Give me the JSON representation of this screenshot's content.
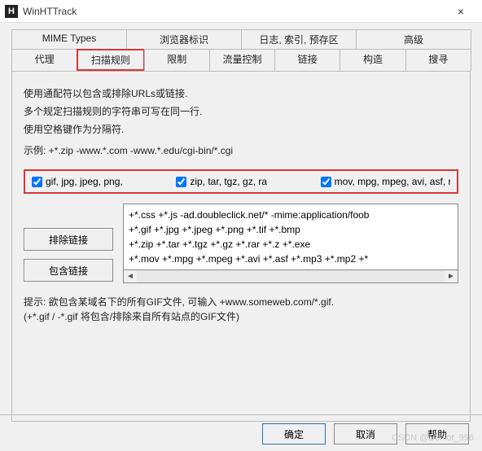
{
  "window": {
    "icon_letter": "H",
    "title": "WinHTTrack",
    "close": "×"
  },
  "tabs_row1": [
    {
      "label": "MIME Types"
    },
    {
      "label": "浏览器标识"
    },
    {
      "label": "日志, 索引, 预存区"
    },
    {
      "label": "高级"
    }
  ],
  "tabs_row2": [
    {
      "label": "代理"
    },
    {
      "label": "扫描规则",
      "active": true
    },
    {
      "label": "限制"
    },
    {
      "label": "流量控制"
    },
    {
      "label": "链接"
    },
    {
      "label": "构造"
    },
    {
      "label": "搜寻"
    }
  ],
  "instructions": {
    "line1": "使用通配符以包含或排除URLs或链接.",
    "line2": "多个规定扫描规则的字符串可写在同一行.",
    "line3": "使用空格键作为分隔符.",
    "example_label": "示例: ",
    "example_text": "+*.zip -www.*.com -www.*.edu/cgi-bin/*.cgi"
  },
  "checkboxes": [
    {
      "label": "gif, jpg, jpeg, png, ",
      "checked": true
    },
    {
      "label": "zip, tar, tgz, gz, ra",
      "checked": true
    },
    {
      "label": "mov, mpg, mpeg, avi, asf, mp",
      "checked": true
    }
  ],
  "sidebuttons": {
    "exclude": "排除链接",
    "include": "包含链接"
  },
  "rules_text": "+*.css +*.js -ad.doubleclick.net/* -mime:application/foob\n+*.gif +*.jpg +*.jpeg +*.png +*.tif +*.bmp\n+*.zip +*.tar +*.tgz +*.gz +*.rar +*.z +*.exe\n+*.mov +*.mpg +*.mpeg +*.avi +*.asf +*.mp3 +*.mp2 +*",
  "hint": {
    "line1_prefix": "提示: 欲包含某域名下的所有GIF文件, 可输入 ",
    "line1_value": "+www.someweb.com/*.gif.",
    "line2": "(+*.gif / -*.gif 将包含/排除来自所有站点的GIF文件)"
  },
  "footer": {
    "ok": "确定",
    "cancel": "取消",
    "help": "帮助"
  },
  "watermark": "CSDN @DoNot_996"
}
